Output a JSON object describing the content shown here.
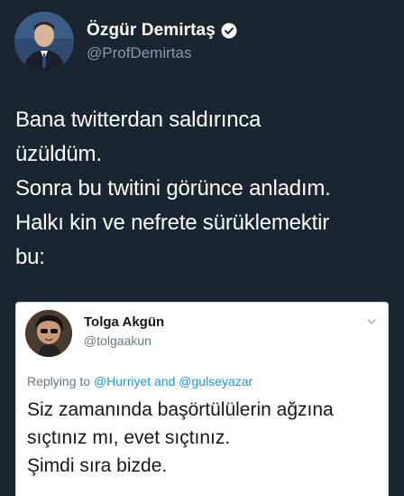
{
  "tweet": {
    "author_name": "Özgür Demirtaş",
    "author_handle": "@ProfDemirtas",
    "verified": true,
    "text_lines": [
      "Bana twitterdan saldırınca",
      "üzüldüm.",
      "Sonra bu twitini görünce anladım.",
      "Halkı kin ve nefrete sürüklemektir",
      "bu:"
    ]
  },
  "quoted": {
    "author_name": "Tolga Akgün",
    "author_handle": "@tolgaakun",
    "replying_prefix": "Replying to",
    "mention_1": "@Hurriyet",
    "and_word": "and",
    "mention_2": "@gulseyazar",
    "text_lines": [
      "Siz zamanında başörtülülerin ağzına",
      "sıçtınız mı, evet sıçtınız.",
      "Şimdi sıra bizde."
    ]
  },
  "colors": {
    "background": "#1b2431",
    "mention": "#1b95e0",
    "verified": "#ffffff"
  },
  "icons": [
    "verified-badge-icon",
    "chevron-down-icon"
  ]
}
